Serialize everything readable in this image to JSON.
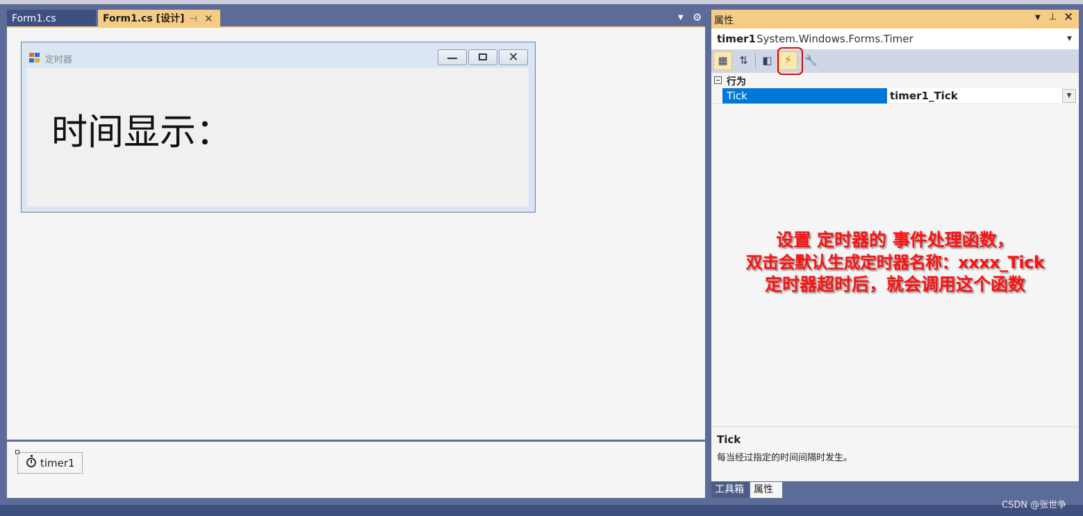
{
  "tabs": {
    "inactive_label": "Form1.cs",
    "active_label": "Form1.cs [设计]",
    "pin_glyph": "⊣",
    "close_glyph": "✕",
    "dropdown_glyph": "▼",
    "gear_glyph": "⚙"
  },
  "designer": {
    "form_caption": "定时器",
    "time_label": "时间显示：",
    "caption_close_glyph": "✕"
  },
  "tray": {
    "component_name": "timer1",
    "icon": "stopwatch-icon"
  },
  "properties": {
    "title": "属性",
    "header_dropdown": "▼",
    "header_pin": "⊥",
    "header_close": "✕",
    "object_name": "timer1",
    "object_type": "System.Windows.Forms.Timer",
    "object_dropdown": "▼",
    "toolbar": {
      "categorized_glyph": "▦",
      "alphabetical_glyph": "⇅",
      "property_pages_glyph": "◧",
      "events_glyph": "⚡",
      "wrench_glyph": "🔧"
    },
    "category": "行为",
    "rows": [
      {
        "name": "Tick",
        "value": "timer1_Tick"
      }
    ],
    "value_dropdown": "▼",
    "description_title": "Tick",
    "description_text": "每当经过指定的时间间隔时发生。"
  },
  "annotation": {
    "line1": "设置 定时器的 事件处理函数，",
    "line2": "双击会默认生成定时器名称：xxxx_Tick",
    "line3": "定时器超时后，就会调用这个函数"
  },
  "bottom_tabs": [
    "工具箱",
    "属性"
  ],
  "watermark": "CSDN @张世争",
  "colors": {
    "accent_tab": "#f5cc84",
    "frame": "#5d6b99",
    "selection": "#0078d7",
    "annotation": "#ff1010"
  }
}
